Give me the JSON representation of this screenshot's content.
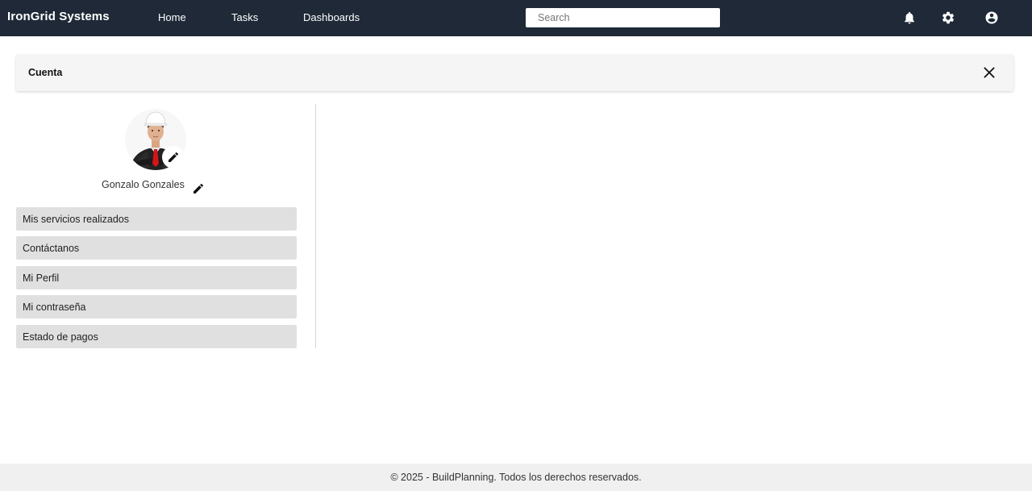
{
  "navbar": {
    "brand": "IronGrid Systems",
    "links": [
      "Home",
      "Tasks",
      "Dashboards"
    ],
    "search_placeholder": "Search",
    "icons": [
      "bell-icon",
      "gear-icon",
      "account-icon"
    ],
    "background_color": "#1f2937"
  },
  "header": {
    "title": "Cuenta"
  },
  "profile": {
    "name": "Gonzalo Gonzales"
  },
  "menu": {
    "items": [
      "Mis servicios realizados",
      "Contáctanos",
      "Mi Perfil",
      "Mi contraseña",
      "Estado de pagos"
    ]
  },
  "footer": {
    "text": "© 2025 - BuildPlanning. Todos los derechos reservados."
  }
}
